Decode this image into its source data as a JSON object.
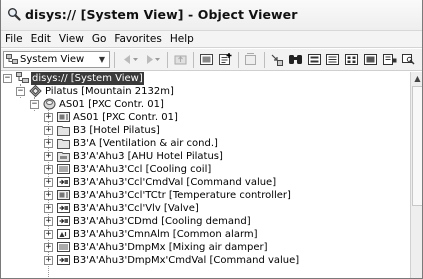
{
  "window": {
    "title": "disys:// [System View] - Object Viewer",
    "icon": "magnifier-icon"
  },
  "menu": {
    "items": [
      "File",
      "Edit",
      "View",
      "Go",
      "Favorites",
      "Help"
    ]
  },
  "toolbar": {
    "view_selector": {
      "value": "System View",
      "icon": "system-view-icon"
    },
    "buttons": [
      "back",
      "forward",
      "up",
      "properties",
      "new",
      "delete",
      "link",
      "find",
      "view-1",
      "view-2",
      "view-3",
      "view-4",
      "view-5"
    ]
  },
  "tree": {
    "root": "disys:// [System View]",
    "site": "Pilatus [Mountain 2132m]",
    "station": "AS01 [PXC Contr. 01]",
    "items": [
      {
        "label": "AS01 [PXC Contr. 01]",
        "icon": "controller-icon"
      },
      {
        "label": "B3 [Hotel Pilatus]",
        "icon": "folder-icon"
      },
      {
        "label": "B3'A [Ventilation & air cond.]",
        "icon": "folder-icon"
      },
      {
        "label": "B3'A'Ahu3 [AHU Hotel Pilatus]",
        "icon": "ahu-icon"
      },
      {
        "label": "B3'A'Ahu3'Ccl [Cooling coil]",
        "icon": "coil-icon"
      },
      {
        "label": "B3'A'Ahu3'Ccl'CmdVal [Command value]",
        "icon": "value-icon"
      },
      {
        "label": "B3'A'Ahu3'Ccl'TCtr [Temperature controller]",
        "icon": "controller-icon"
      },
      {
        "label": "B3'A'Ahu3'Ccl'Vlv [Valve]",
        "icon": "value-icon"
      },
      {
        "label": "B3'A'Ahu3'CDmd [Cooling demand]",
        "icon": "value-icon"
      },
      {
        "label": "B3'A'Ahu3'CmnAlm [Common alarm]",
        "icon": "alarm-icon"
      },
      {
        "label": "B3'A'Ahu3'DmpMx [Mixing air damper]",
        "icon": "coil-icon"
      },
      {
        "label": "B3'A'Ahu3'DmpMx'CmdVal [Command value]",
        "icon": "value-icon"
      }
    ]
  }
}
